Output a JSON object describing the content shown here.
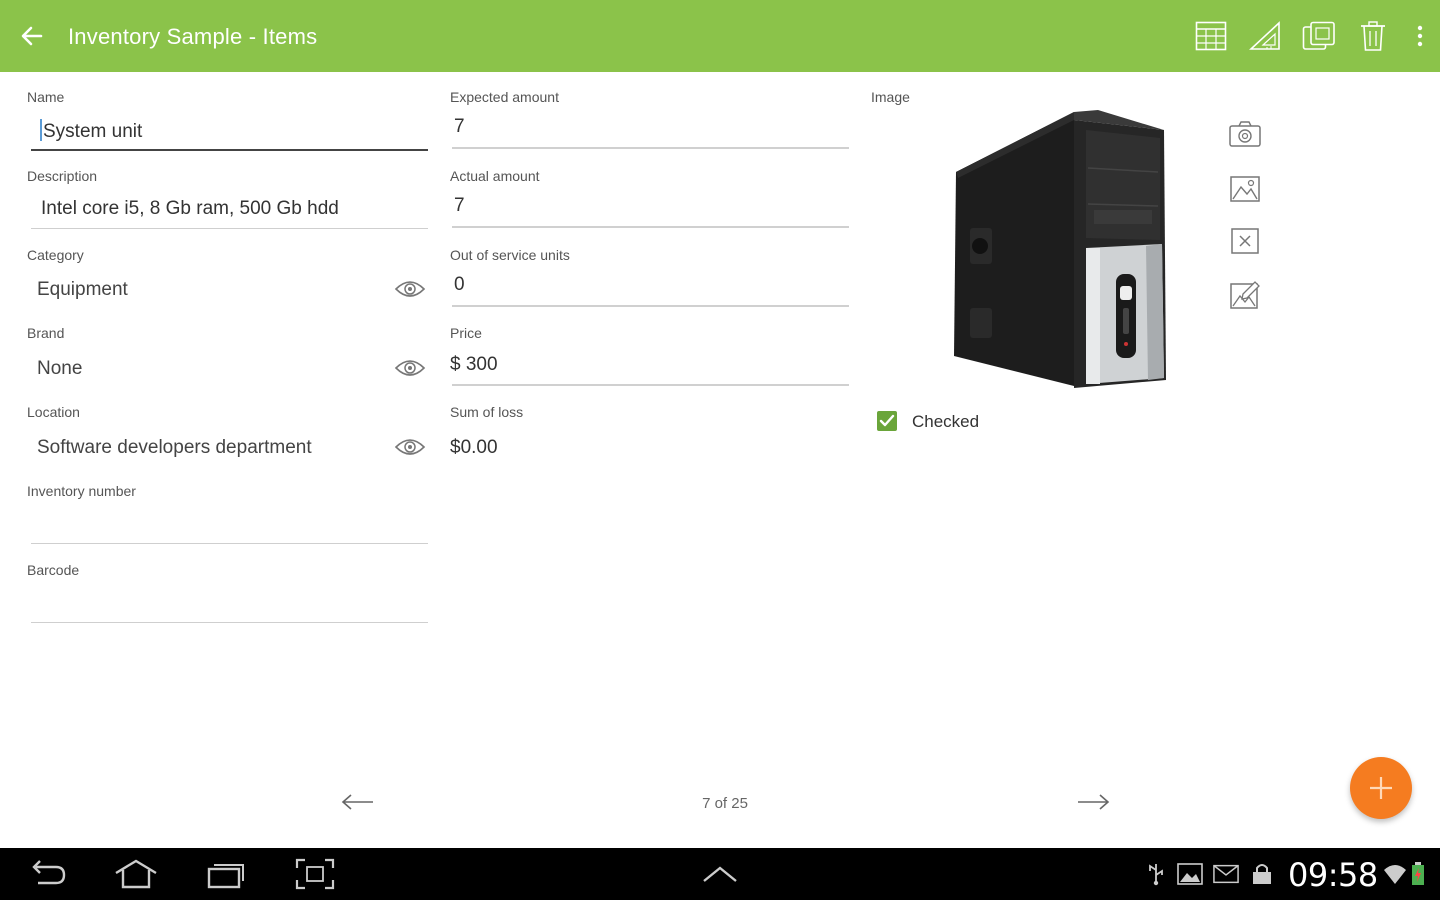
{
  "actionbar": {
    "title": "Inventory Sample - Items",
    "color": "#8bc34a",
    "icons": [
      "back-arrow-icon",
      "table-icon",
      "ruler-triangle-icon",
      "copy-icon",
      "trash-icon",
      "overflow-menu-icon"
    ]
  },
  "form": {
    "name": {
      "label": "Name",
      "value": "System unit"
    },
    "description": {
      "label": "Description",
      "value": "Intel core i5, 8 Gb ram, 500 Gb hdd"
    },
    "category": {
      "label": "Category",
      "value": "Equipment"
    },
    "brand": {
      "label": "Brand",
      "value": "None"
    },
    "location": {
      "label": "Location",
      "value": "Software developers department"
    },
    "inventory_number": {
      "label": "Inventory number",
      "value": ""
    },
    "barcode": {
      "label": "Barcode",
      "value": ""
    },
    "expected_amount": {
      "label": "Expected amount",
      "value": "7"
    },
    "actual_amount": {
      "label": "Actual amount",
      "value": "7"
    },
    "out_of_service": {
      "label": "Out of service units",
      "value": "0"
    },
    "price": {
      "label": "Price",
      "value": "$ 300"
    },
    "sum_of_loss": {
      "label": "Sum of loss",
      "value": "$0.00"
    }
  },
  "image_panel": {
    "label": "Image",
    "buttons": [
      "camera-icon",
      "gallery-icon",
      "remove-image-icon",
      "edit-image-icon"
    ],
    "checked_label": "Checked",
    "checked": true
  },
  "pager": {
    "text": "7 of 25"
  },
  "fab": {
    "color": "#f57c20"
  },
  "statusbar": {
    "time": "09:58"
  }
}
